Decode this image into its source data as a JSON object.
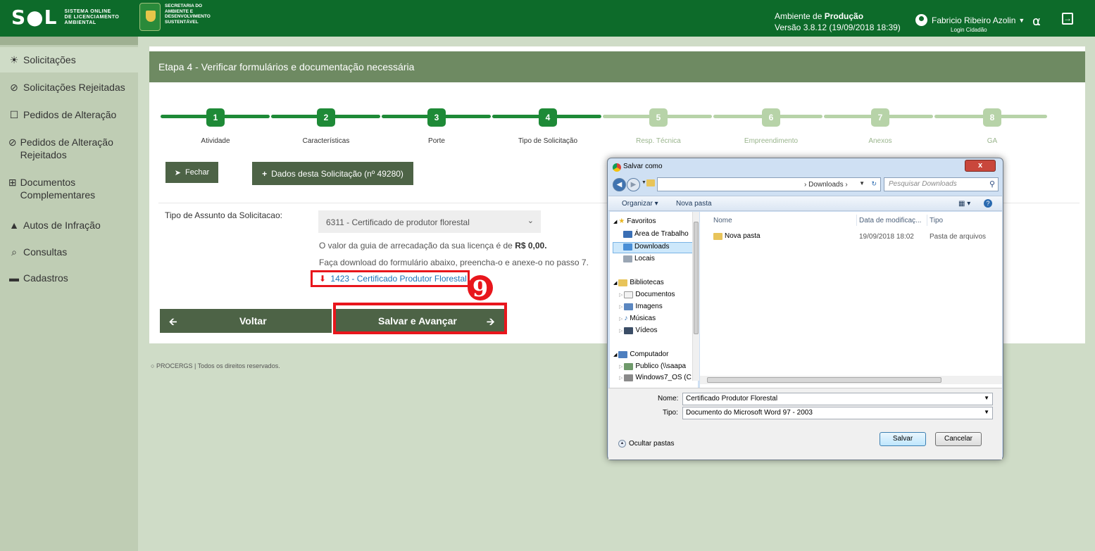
{
  "header": {
    "logo_main": "S●L",
    "logo_sub": [
      "SISTEMA ONLINE",
      "DE LICENCIAMENTO",
      "AMBIENTAL"
    ],
    "secretaria": [
      "SECRETARIA DO",
      "AMBIENTE E",
      "DESENVOLVIMENTO",
      "SUSTENTÁVEL"
    ],
    "env_prefix": "Ambiente de ",
    "env_name": "Produção",
    "version": "Versão 3.8.12 (19/09/2018 18:39)",
    "user_name": "Fabricio Ribeiro Azolin",
    "login_type": "Login Cidadão",
    "bell_icon": "🔔",
    "exit_icon": "→"
  },
  "sidebar": {
    "items": [
      {
        "label": "Solicitações",
        "icon": "☀"
      },
      {
        "label": "Solicitações Rejeitadas",
        "icon": "⊘"
      },
      {
        "label": "Pedidos de Alteração",
        "icon": "☐"
      },
      {
        "label": "Pedidos de Alteração Rejeitados",
        "icon": "⊘"
      },
      {
        "label": "Documentos Complementares",
        "icon": "⊞"
      },
      {
        "label": "Autos de Infração",
        "icon": "▲"
      },
      {
        "label": "Consultas",
        "icon": "⌕"
      },
      {
        "label": "Cadastros",
        "icon": "▬"
      }
    ]
  },
  "main": {
    "title": "Etapa 4 - Verificar formulários e documentação necessária",
    "steps": [
      {
        "num": "1",
        "label": "Atividade"
      },
      {
        "num": "2",
        "label": "Características"
      },
      {
        "num": "3",
        "label": "Porte"
      },
      {
        "num": "4",
        "label": "Tipo de Solicitação"
      },
      {
        "num": "5",
        "label": "Resp. Técnica"
      },
      {
        "num": "6",
        "label": "Empreendimento"
      },
      {
        "num": "7",
        "label": "Anexos"
      },
      {
        "num": "8",
        "label": "GA"
      }
    ],
    "btn_fechar": "Fechar",
    "btn_dados": "Dados desta Solicitação (nº 49280)",
    "assunto_label": "Tipo de Assunto da Solicitacao:",
    "assunto_value": "6311 - Certificado de produtor florestal",
    "valor_prefix": "O valor da guia de arrecadação da sua licença é de ",
    "valor_amount": "R$ 0,00.",
    "download_text": "Faça download do formulário abaixo, preencha-o e anexe-o no passo 7.",
    "download_link": "1423 - Certificado Produtor Florestal",
    "badge": "9",
    "btn_voltar": "Voltar",
    "btn_salvar": "Salvar e Avançar",
    "footer": "PROCERGS | Todos os direitos reservados."
  },
  "dialog": {
    "title": "Salvar como",
    "close": "x",
    "address": "› Downloads ›",
    "search_placeholder": "Pesquisar Downloads",
    "organizar": "Organizar ▾",
    "nova_pasta": "Nova pasta",
    "tree": {
      "favoritos": "Favoritos",
      "area": "Área de Trabalho",
      "downloads": "Downloads",
      "locais": "Locais",
      "bibliotecas": "Bibliotecas",
      "documentos": "Documentos",
      "imagens": "Imagens",
      "musicas": "Músicas",
      "videos": "Vídeos",
      "computador": "Computador",
      "publico": "Publico (\\\\saapa",
      "windows": "Windows7_OS (C"
    },
    "columns": {
      "nome": "Nome",
      "data": "Data de modificaç...",
      "tipo": "Tipo"
    },
    "files": [
      {
        "name": "Nova pasta",
        "date": "19/09/2018 18:02",
        "type": "Pasta de arquivos"
      }
    ],
    "nome_label": "Nome:",
    "nome_value": "Certificado Produtor Florestal",
    "tipo_label": "Tipo:",
    "tipo_value": "Documento do Microsoft Word 97 - 2003",
    "ocultar": "Ocultar pastas",
    "btn_salvar": "Salvar",
    "btn_cancelar": "Cancelar"
  },
  "colors": {
    "header": "#0d6b2a",
    "step_done": "#1e8a37",
    "step_todo": "#b7d3a8",
    "highlight": "#e8161c"
  }
}
